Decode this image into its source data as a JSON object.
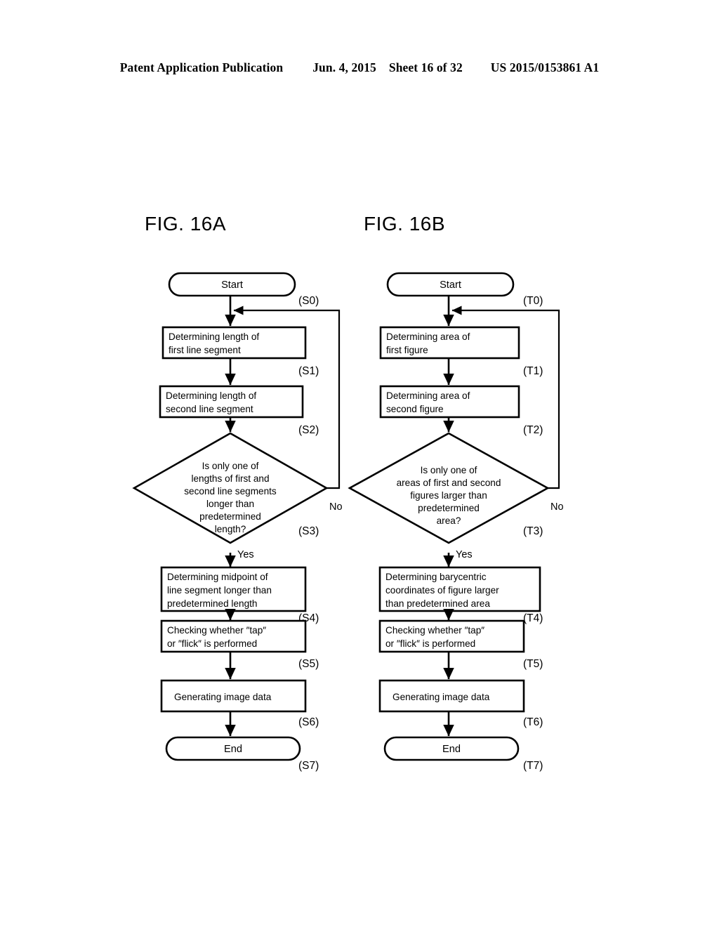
{
  "header": {
    "publication": "Patent Application Publication",
    "date": "Jun. 4, 2015",
    "sheet": "Sheet 16 of 32",
    "number": "US 2015/0153861 A1"
  },
  "figures": {
    "a": {
      "title": "FIG. 16A",
      "start": {
        "label": "Start",
        "step": "(S0)"
      },
      "steps": [
        {
          "lines": [
            "Determining length of",
            "first line segment"
          ],
          "step": "(S1)"
        },
        {
          "lines": [
            "Determining length of",
            "second line segment"
          ],
          "step": "(S2)"
        }
      ],
      "decision": {
        "lines": [
          "Is only one of",
          "lengths of first and",
          "second line segments",
          "longer than",
          "predetermined",
          "length?"
        ],
        "step": "(S3)",
        "yes": "Yes",
        "no": "No"
      },
      "steps_after": [
        {
          "lines": [
            "Determining midpoint of",
            "line segment longer than",
            "predetermined length"
          ],
          "step": "(S4)"
        },
        {
          "lines": [
            "Checking whether ″tap″",
            "or ″flick″ is performed"
          ],
          "step": "(S5)"
        },
        {
          "lines": [
            "Generating image data"
          ],
          "step": "(S6)"
        }
      ],
      "end": {
        "label": "End",
        "step": "(S7)"
      }
    },
    "b": {
      "title": "FIG. 16B",
      "start": {
        "label": "Start",
        "step": "(T0)"
      },
      "steps": [
        {
          "lines": [
            "Determining area of",
            "first figure"
          ],
          "step": "(T1)"
        },
        {
          "lines": [
            "Determining area of",
            "second figure"
          ],
          "step": "(T2)"
        }
      ],
      "decision": {
        "lines": [
          "Is only one of",
          "areas of first and second",
          "figures larger than",
          "predetermined",
          "area?"
        ],
        "step": "(T3)",
        "yes": "Yes",
        "no": "No"
      },
      "steps_after": [
        {
          "lines": [
            "Determining barycentric",
            "coordinates of figure larger",
            "than predetermined area"
          ],
          "step": "(T4)"
        },
        {
          "lines": [
            "Checking whether ″tap″",
            "or ″flick″ is performed"
          ],
          "step": "(T5)"
        },
        {
          "lines": [
            "Generating image data"
          ],
          "step": "(T6)"
        }
      ],
      "end": {
        "label": "End",
        "step": "(T7)"
      }
    }
  },
  "colors": {
    "ink": "#000000",
    "paper": "#ffffff"
  }
}
